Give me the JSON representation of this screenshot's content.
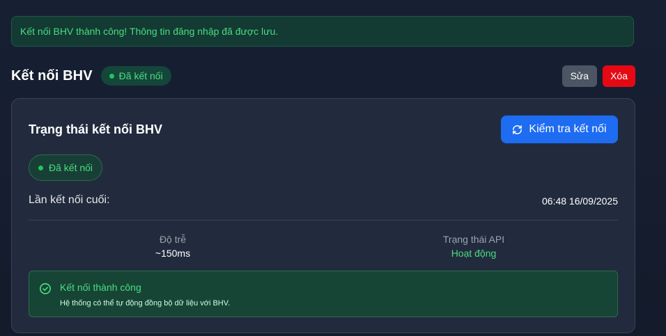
{
  "alert": {
    "message": "Kết nối BHV thành công! Thông tin đăng nhập đã được lưu."
  },
  "header": {
    "title": "Kết nối BHV",
    "status_badge": "Đã kết nối",
    "edit_label": "Sửa",
    "delete_label": "Xóa"
  },
  "card": {
    "title": "Trạng thái kết nối BHV",
    "check_button_label": "Kiểm tra kết nối",
    "status_badge": "Đã kết nối",
    "last_connection_label": "Lần kết nối cuối:",
    "last_connection_value": "06:48 16/09/2025",
    "stats": {
      "latency_label": "Độ trễ",
      "latency_value": "~150ms",
      "api_label": "Trạng thái API",
      "api_value": "Hoạt động"
    },
    "success": {
      "title": "Kết nối thành công",
      "description": "Hệ thống có thể tự động đồng bộ dữ liệu với BHV."
    }
  },
  "icons": {
    "status_dot": "status-dot-icon",
    "refresh": "refresh-icon",
    "check_circle": "check-circle-icon"
  },
  "colors": {
    "accent_green": "#4ade80",
    "primary_blue": "#1d6cf2",
    "danger_red": "#e50914"
  }
}
